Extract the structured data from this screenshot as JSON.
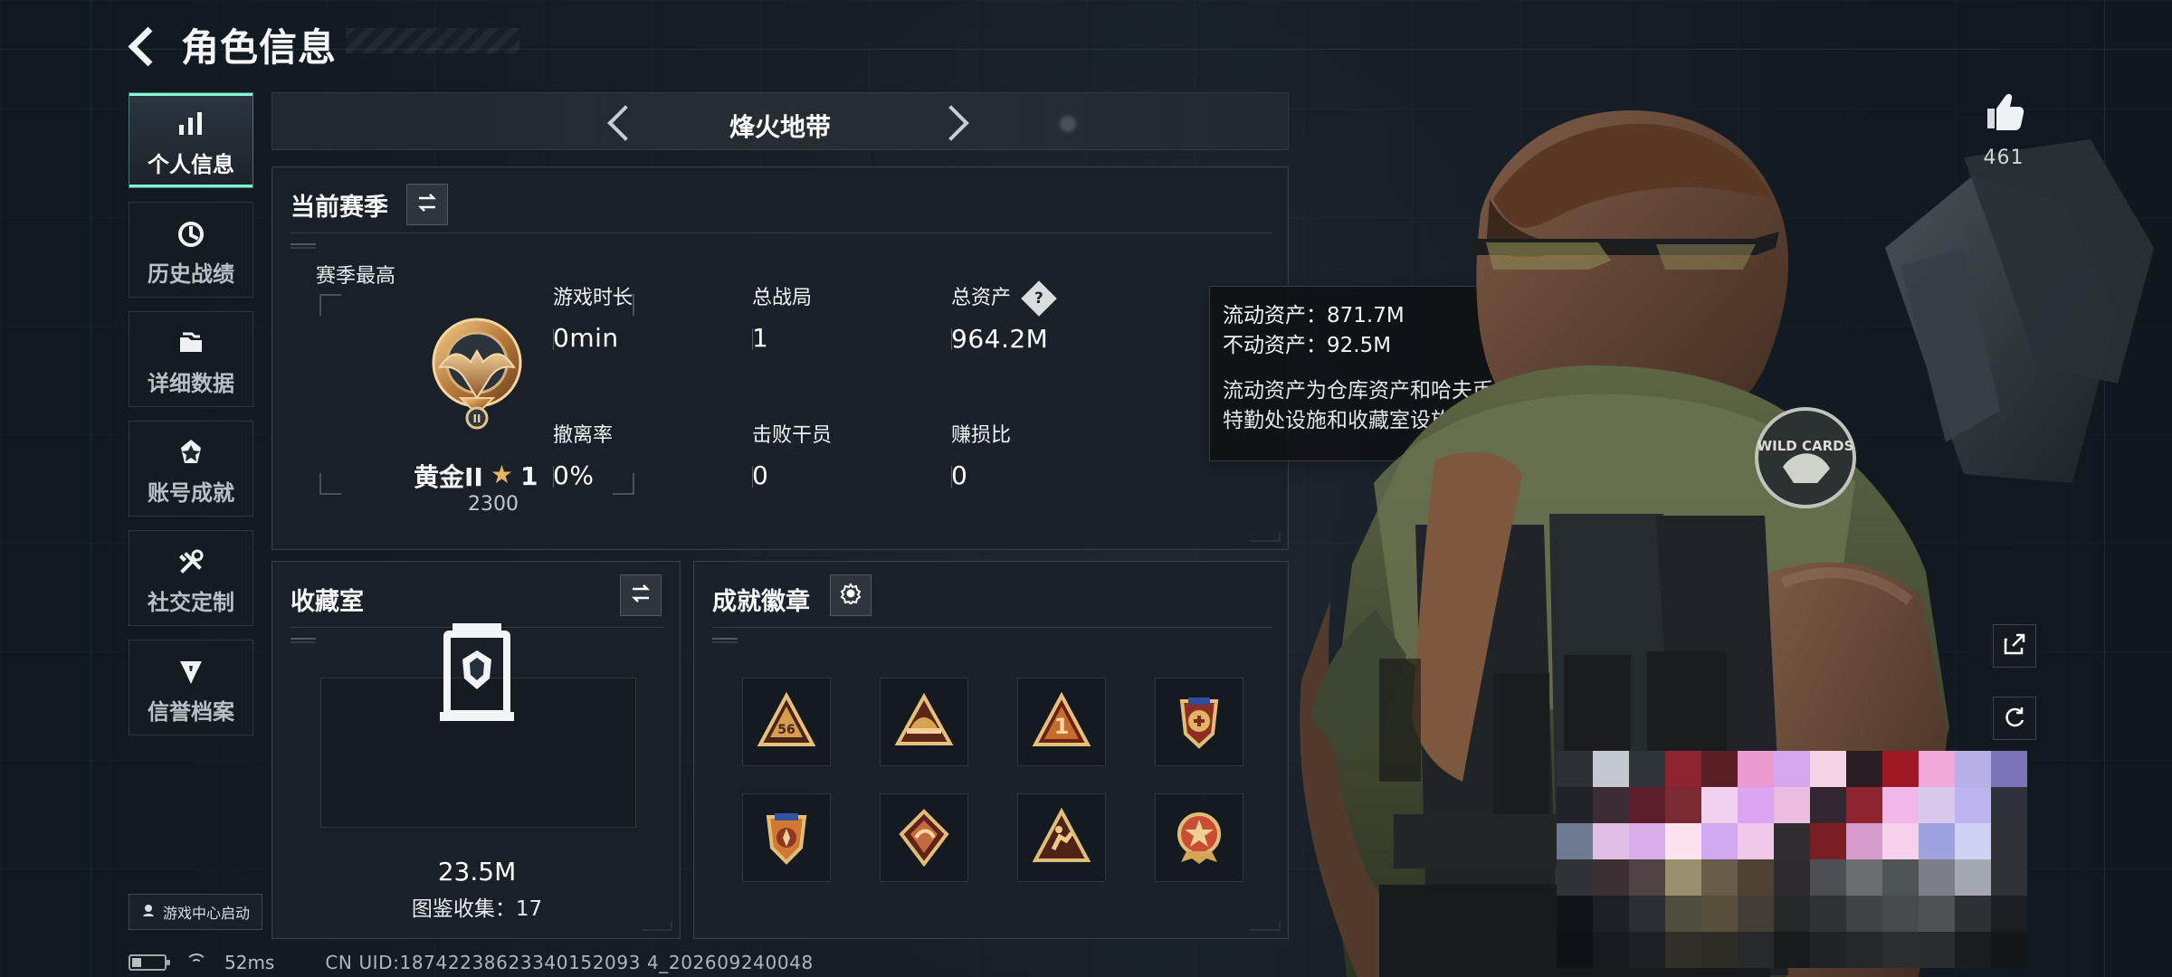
{
  "header": {
    "title": "角色信息"
  },
  "left_nav": {
    "items": [
      {
        "label": "个人信息",
        "icon": "bar-chart-icon",
        "active": true
      },
      {
        "label": "历史战绩",
        "icon": "history-icon",
        "active": false
      },
      {
        "label": "详细数据",
        "icon": "folder-icon",
        "active": false
      },
      {
        "label": "账号成就",
        "icon": "achievement-icon",
        "active": false
      },
      {
        "label": "社交定制",
        "icon": "tools-icon",
        "active": false
      },
      {
        "label": "信誉档案",
        "icon": "credit-icon",
        "active": false
      }
    ],
    "game_center_label": "游戏中心启动"
  },
  "mode_selector": {
    "title": "烽火地带"
  },
  "season_card": {
    "title": "当前赛季",
    "best_label": "赛季最高",
    "rank_name": "黄金II",
    "rank_star_count": "1",
    "rank_score": "2300",
    "stats": [
      {
        "label": "游戏时长",
        "value": "0min"
      },
      {
        "label": "总战局",
        "value": "1"
      },
      {
        "label": "总资产",
        "value": "964.2M"
      },
      {
        "label": "撤离率",
        "value": "0%"
      },
      {
        "label": "击败干员",
        "value": "0"
      },
      {
        "label": "赚损比",
        "value": "0"
      }
    ]
  },
  "tooltip": {
    "liquid_assets": "流动资产：871.7M",
    "fixed_assets": "不动资产：92.5M",
    "note": "流动资产为仓库资产和哈夫币，不动资产为特勤处设施和收藏室设施"
  },
  "collection_card": {
    "title": "收藏室",
    "value": "23.5M",
    "count_label": "图鉴收集：17"
  },
  "achievement_card": {
    "title": "成就徽章"
  },
  "right_side": {
    "like_count": "461"
  },
  "status_bar": {
    "ping": "52ms",
    "uid": "CN UID:18742238623340152093 4_202609240048"
  },
  "colors": {
    "accent": "#88f7d2",
    "gold": "#d8a754",
    "panel": "#1b2128"
  }
}
